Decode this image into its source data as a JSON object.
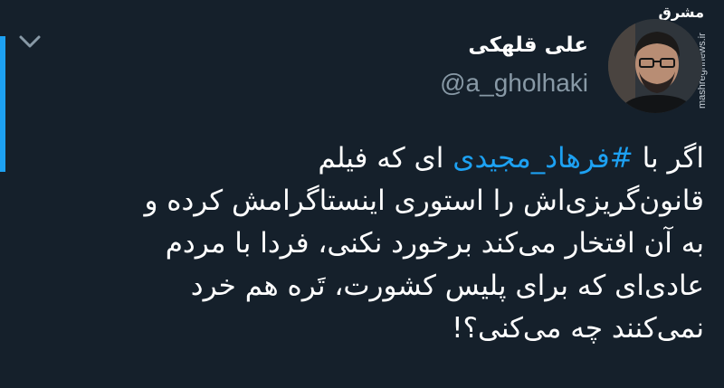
{
  "watermark": {
    "site": "mashreghnews.ir",
    "logo": "مشرق"
  },
  "author": {
    "display_name": "علی قلهکی",
    "handle": "@a_gholhaki",
    "avatar_icon": "user-photo-icon"
  },
  "menu_icon": "chevron-down-icon",
  "tweet": {
    "line1_prefix": "اگر با",
    "hashtag": "#فرهاد_مجیدی",
    "line1_suffix": "ای که فیلم",
    "line2": "قانون‌گریزی‌اش را استوری اینستاگرامش کرده و",
    "line3": "به آن افتخار می‌کند برخورد نکنی، فردا با مردم",
    "line4": "عادی‌ای که برای پلیس کشورت، تَره هم خرد",
    "line5": "نمی‌کنند چه می‌کنی؟!"
  },
  "colors": {
    "background": "#15202b",
    "accent": "#1da1f2",
    "secondary_text": "#8899a6"
  }
}
